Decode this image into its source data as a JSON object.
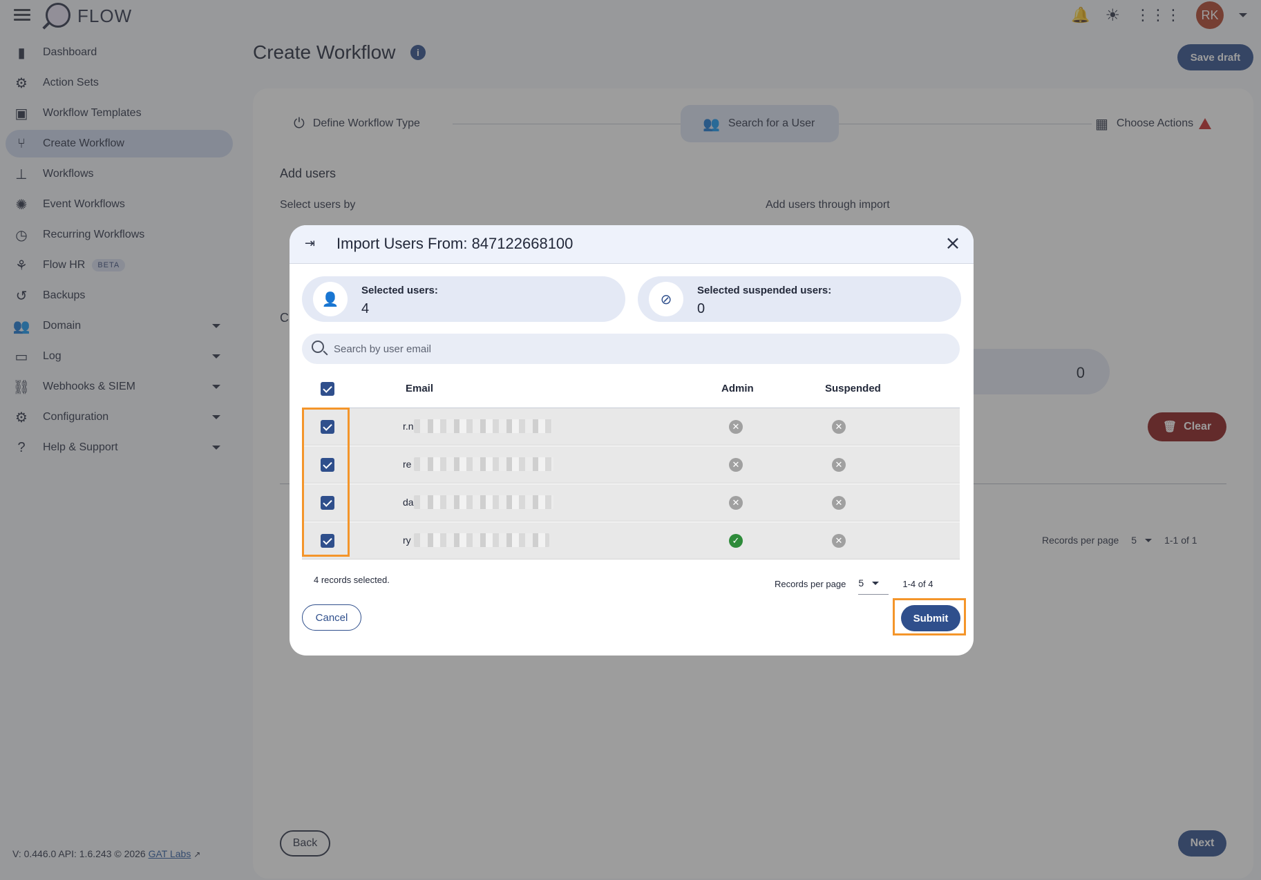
{
  "app": {
    "name": "FLOW",
    "avatar_initials": "RK"
  },
  "sidebar": {
    "items": [
      {
        "label": "Dashboard",
        "icon": "bar-chart-icon",
        "glyph": "▮"
      },
      {
        "label": "Action Sets",
        "icon": "gears-icon",
        "glyph": "⚙"
      },
      {
        "label": "Workflow Templates",
        "icon": "template-icon",
        "glyph": "▣"
      },
      {
        "label": "Create Workflow",
        "icon": "fork-icon",
        "glyph": "⑂",
        "active": true
      },
      {
        "label": "Workflows",
        "icon": "hierarchy-icon",
        "glyph": "⊥"
      },
      {
        "label": "Event Workflows",
        "icon": "alarm-icon",
        "glyph": "✺"
      },
      {
        "label": "Recurring Workflows",
        "icon": "clock-icon",
        "glyph": "◷"
      },
      {
        "label": "Flow HR",
        "icon": "hr-icon",
        "glyph": "⚘",
        "badge": "BETA"
      },
      {
        "label": "Backups",
        "icon": "restore-icon",
        "glyph": "↺"
      },
      {
        "label": "Domain",
        "icon": "group-icon",
        "glyph": "👥",
        "expandable": true
      },
      {
        "label": "Log",
        "icon": "log-icon",
        "glyph": "▭",
        "expandable": true
      },
      {
        "label": "Webhooks & SIEM",
        "icon": "webhook-icon",
        "glyph": "⛓",
        "expandable": true
      },
      {
        "label": "Configuration",
        "icon": "gear-icon",
        "glyph": "⚙",
        "expandable": true
      },
      {
        "label": "Help & Support",
        "icon": "help-icon",
        "glyph": "?",
        "expandable": true
      }
    ],
    "footer": {
      "version": "V: 0.446.0  API: 1.6.243  © 2026",
      "link": "GAT Labs"
    }
  },
  "page": {
    "title": "Create Workflow",
    "save_draft": "Save draft",
    "steps": [
      "Define Workflow Type",
      "Search for a User",
      "Choose Actions"
    ],
    "section_title": "Add users",
    "select_by_label": "Select users by",
    "import_label": "Add users through import",
    "bg_count": "0",
    "clear_label": "Clear",
    "bg_rpp_label": "Records per page",
    "bg_rpp_value": "5",
    "bg_range": "1-1 of 1",
    "back_label": "Back",
    "next_label": "Next",
    "partial_letter": "C"
  },
  "modal": {
    "title": "Import Users From: 847122668100",
    "selected_users_label": "Selected users:",
    "selected_users_value": "4",
    "selected_suspended_label": "Selected suspended users:",
    "selected_suspended_value": "0",
    "search_placeholder": "Search by user email",
    "columns": {
      "email": "Email",
      "admin": "Admin",
      "suspended": "Suspended"
    },
    "rows": [
      {
        "email_visible": "r.n",
        "checked": true,
        "admin": false,
        "suspended": false
      },
      {
        "email_visible": "re",
        "checked": true,
        "admin": false,
        "suspended": false
      },
      {
        "email_visible": "da",
        "checked": true,
        "admin": false,
        "suspended": false
      },
      {
        "email_visible": "ry",
        "checked": true,
        "admin": true,
        "suspended": false
      }
    ],
    "records_selected": "4 records selected.",
    "rpp_label": "Records per page",
    "rpp_value": "5",
    "range": "1-4 of 4",
    "cancel_label": "Cancel",
    "submit_label": "Submit"
  }
}
